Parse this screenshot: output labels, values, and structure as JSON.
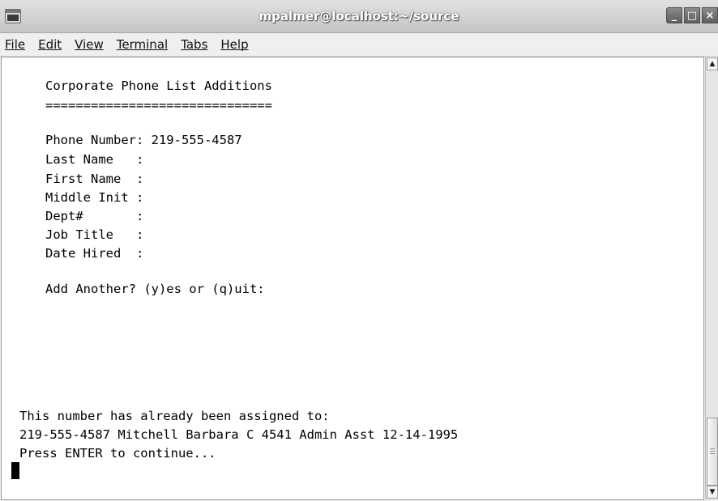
{
  "window": {
    "title": "mpalmer@localhost:~/source",
    "controls": {
      "minimize": "_",
      "maximize": "□",
      "close": "×"
    }
  },
  "menu": [
    {
      "label": "File"
    },
    {
      "label": "Edit"
    },
    {
      "label": "View"
    },
    {
      "label": "Terminal"
    },
    {
      "label": "Tabs"
    },
    {
      "label": "Help"
    }
  ],
  "terminal": {
    "header": "Corporate Phone List Additions",
    "underline": "==============================",
    "fields": {
      "phone": "Phone Number: 219-555-4587",
      "last_name": "Last Name   :",
      "first_name": "First Name  :",
      "middle_init": "Middle Init :",
      "dept": "Dept#       :",
      "job_title": "Job Title   :",
      "date_hired": "Date Hired  :"
    },
    "prompt": "Add Another? (y)es or (q)uit:",
    "message": {
      "line1": "This number has already been assigned to:",
      "line2": "219-555-4587 Mitchell Barbara C 4541 Admin Asst 12-14-1995",
      "line3": "Press ENTER to continue..."
    }
  },
  "scrollbar": {
    "up_arrow": "▲",
    "down_arrow": "▼"
  },
  "icons": {
    "app": "terminal-icon",
    "cursor": "block-cursor"
  }
}
